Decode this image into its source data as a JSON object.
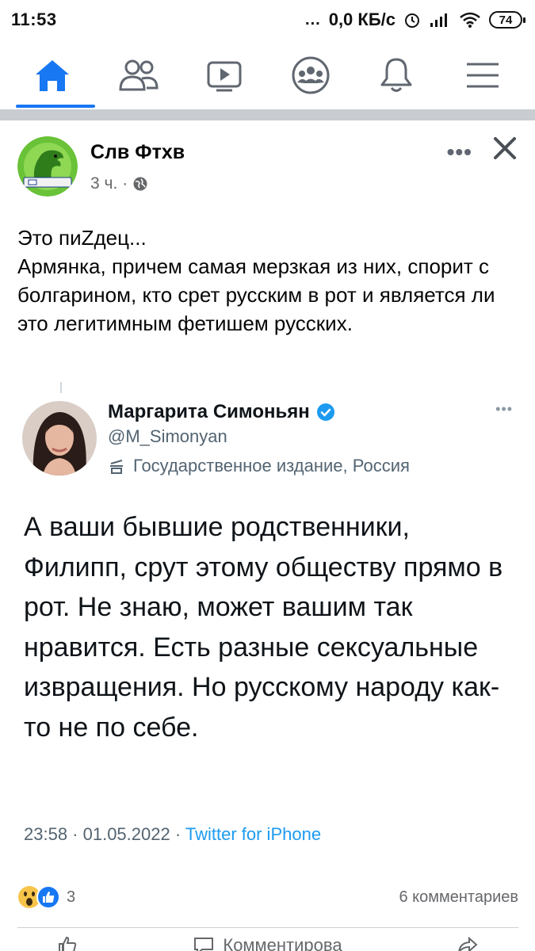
{
  "status_bar": {
    "time": "11:53",
    "dots": "...",
    "speed": "0,0 КБ/с",
    "battery": "74"
  },
  "nav": {
    "active": "home",
    "items": [
      "home-icon",
      "friends-icon",
      "watch-icon",
      "groups-icon",
      "notifications-icon",
      "menu-icon"
    ]
  },
  "post": {
    "author": "Слв Фтхв",
    "time": "3 ч.",
    "meta_sep": "·",
    "text": "Это пиZдец...\nАрмянка, причем самая мерзкая из них, спорит с болгарином, кто срет русским в рот и является ли это легитимным фетишем русских."
  },
  "tweet": {
    "name": "Маргарита Симоньян",
    "handle": "@M_Simonyan",
    "label": "Государственное издание, Россия",
    "body": "А ваши бывшие родственники, Филипп, срут этому обществу прямо в рот. Не знаю, может вашим так нравится. Есть разные сексуальные извращения. Но русскому народу как-то не по себе.",
    "time": "23:58 · 01.05.2022 · ",
    "source": "Twitter for iPhone"
  },
  "reactions": {
    "count": "3",
    "comments": "6 комментариев"
  },
  "actions": {
    "comment_label": "Комментирова"
  },
  "colors": {
    "accent": "#1877f2",
    "twitter_blue": "#1d9bf0",
    "secondary_text": "#65676b"
  }
}
